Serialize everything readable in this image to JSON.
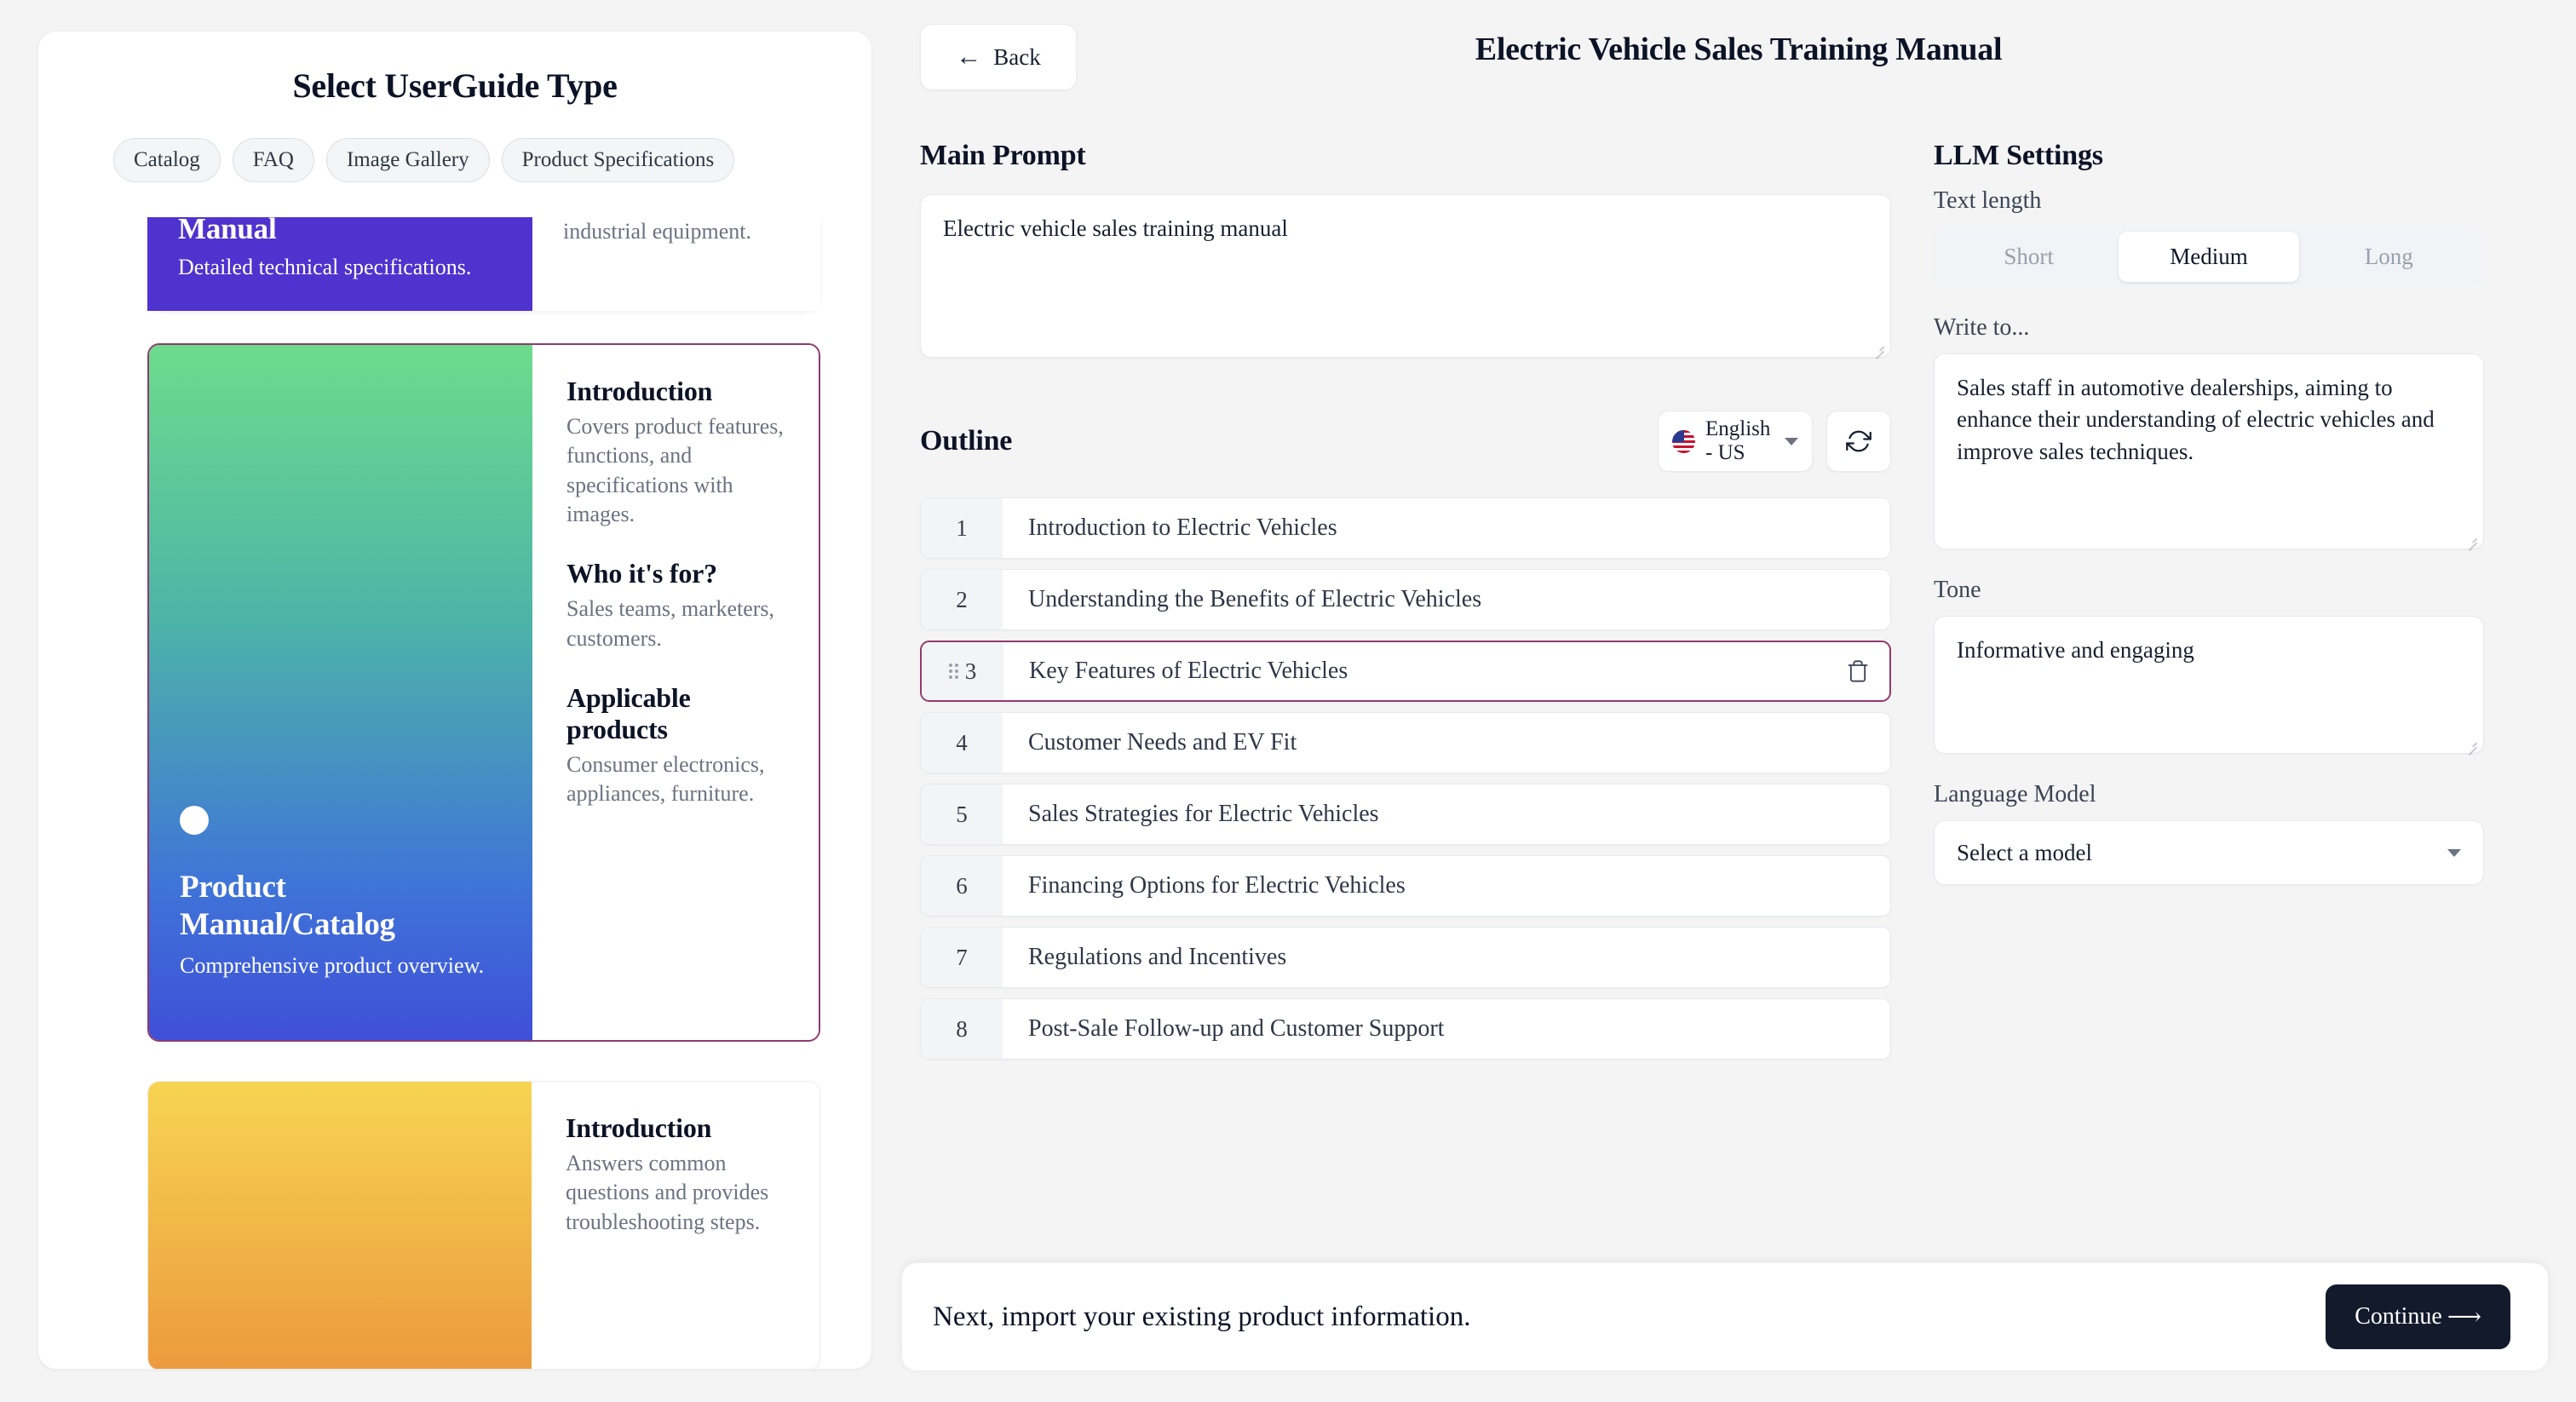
{
  "left_panel": {
    "title": "Select UserGuide Type",
    "chips": [
      "Catalog",
      "FAQ",
      "Image Gallery",
      "Product Specifications"
    ],
    "cards": [
      {
        "title": "Manual",
        "subtitle": "Detailed technical specifications.",
        "detail_text": "industrial equipment."
      },
      {
        "title": "Product Manual/Catalog",
        "subtitle": "Comprehensive product overview.",
        "sections": [
          {
            "heading": "Introduction",
            "body": "Covers product features, functions, and specifications with images."
          },
          {
            "heading": "Who it's for?",
            "body": "Sales teams, marketers, customers."
          },
          {
            "heading": "Applicable products",
            "body": "Consumer electronics, appliances, furniture."
          }
        ]
      },
      {
        "sections": [
          {
            "heading": "Introduction",
            "body": "Answers common questions and provides troubleshooting steps."
          }
        ]
      }
    ]
  },
  "header": {
    "back_label": "Back",
    "back_icon": "arrow-left-icon",
    "doc_title": "Electric Vehicle Sales Training Manual"
  },
  "main": {
    "prompt_heading": "Main Prompt",
    "prompt_value": "Electric vehicle sales training manual",
    "outline_heading": "Outline",
    "language": "English - US",
    "language_flag_icon": "us-flag-icon",
    "refresh_icon": "refresh-icon",
    "outline_items": [
      {
        "number": "1",
        "text": "Introduction to Electric Vehicles"
      },
      {
        "number": "2",
        "text": "Understanding the Benefits of Electric Vehicles"
      },
      {
        "number": "3",
        "text": "Key Features of Electric Vehicles"
      },
      {
        "number": "4",
        "text": "Customer Needs and EV Fit"
      },
      {
        "number": "5",
        "text": "Sales Strategies for Electric Vehicles"
      },
      {
        "number": "6",
        "text": "Financing Options for Electric Vehicles"
      },
      {
        "number": "7",
        "text": "Regulations and Incentives"
      },
      {
        "number": "8",
        "text": "Post-Sale Follow-up and Customer Support"
      }
    ],
    "active_outline_index": 2,
    "drag_handle_icon": "drag-handle-icon",
    "delete_icon": "trash-icon"
  },
  "llm_settings": {
    "heading": "LLM Settings",
    "text_length_label": "Text length",
    "text_length_options": [
      "Short",
      "Medium",
      "Long"
    ],
    "text_length_selected": "Medium",
    "write_to_label": "Write to...",
    "write_to_value": "Sales staff in automotive dealerships, aiming to enhance their understanding of electric vehicles and improve sales techniques.",
    "tone_label": "Tone",
    "tone_value": "Informative and engaging",
    "language_model_label": "Language Model",
    "language_model_value": "Select a model",
    "chevron_icon": "chevron-down-icon"
  },
  "footer": {
    "message": "Next, import your existing product information.",
    "continue_label": "Continue",
    "continue_icon": "arrow-right-icon"
  },
  "colors": {
    "accent_purple": "#4f33cf",
    "selected_border": "#8e3b6e",
    "continue_bg": "#131a2b"
  }
}
